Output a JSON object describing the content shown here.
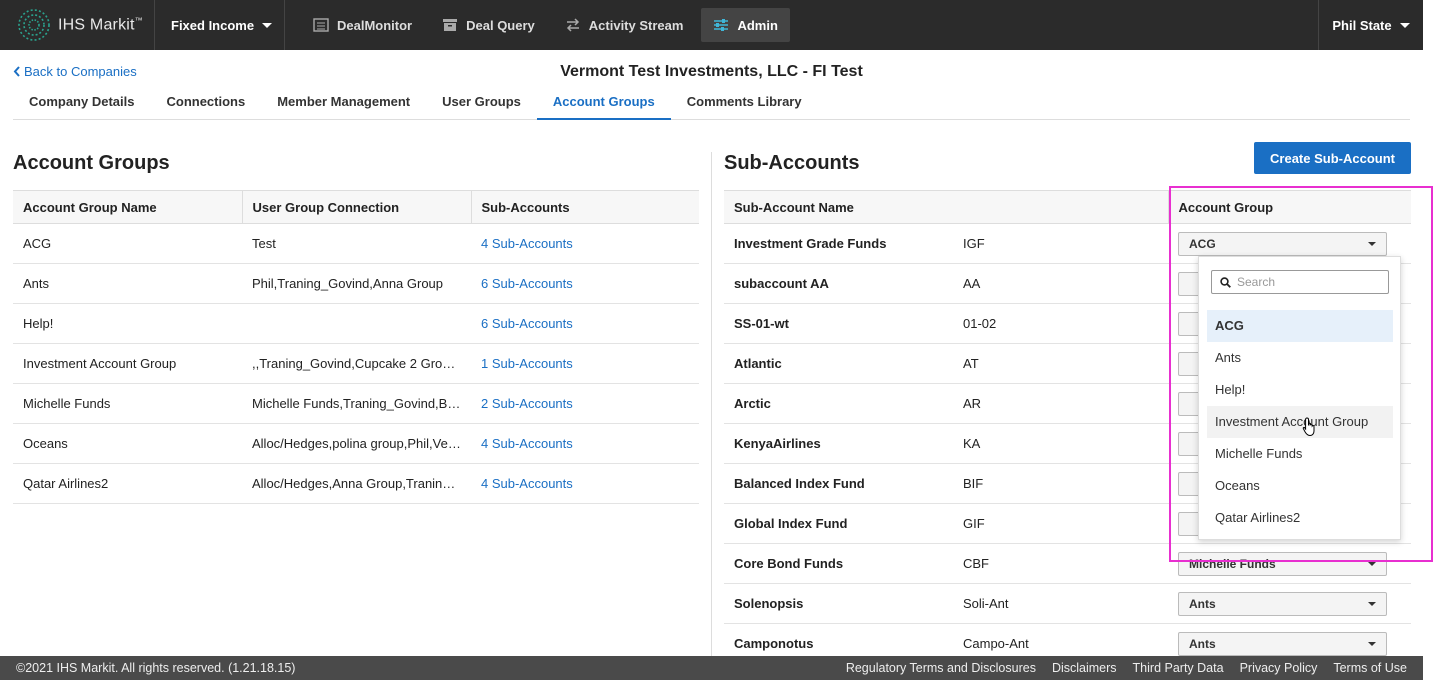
{
  "nav": {
    "brand": "IHS Markit",
    "brand_mark": "™",
    "product": "Fixed Income",
    "links": [
      {
        "label": "DealMonitor",
        "icon": "list-icon"
      },
      {
        "label": "Deal Query",
        "icon": "archive-icon"
      },
      {
        "label": "Activity Stream",
        "icon": "swap-arrows-icon"
      },
      {
        "label": "Admin",
        "icon": "sliders-icon"
      }
    ],
    "user": "Phil State"
  },
  "header": {
    "back_label": "Back to Companies",
    "title": "Vermont Test Investments, LLC - FI Test"
  },
  "tabs": [
    {
      "label": "Company Details"
    },
    {
      "label": "Connections"
    },
    {
      "label": "Member Management"
    },
    {
      "label": "User Groups"
    },
    {
      "label": "Account Groups"
    },
    {
      "label": "Comments Library"
    }
  ],
  "account_groups": {
    "title": "Account Groups",
    "columns": [
      "Account Group Name",
      "User Group Connection",
      "Sub-Accounts"
    ],
    "rows": [
      {
        "name": "ACG",
        "connection": "Test",
        "subs": "4 Sub-Accounts"
      },
      {
        "name": "Ants",
        "connection": "Phil,Traning_Govind,Anna Group",
        "subs": "6 Sub-Accounts"
      },
      {
        "name": "Help!",
        "connection": "",
        "subs": "6 Sub-Accounts"
      },
      {
        "name": "Investment Account Group",
        "connection": ",,Traning_Govind,Cupcake 2 Group,...",
        "subs": "1 Sub-Accounts"
      },
      {
        "name": "Michelle Funds",
        "connection": "Michelle Funds,Traning_Govind,Bu...",
        "subs": "2 Sub-Accounts"
      },
      {
        "name": "Oceans",
        "connection": "Alloc/Hedges,polina group,Phil,Ver...",
        "subs": "4 Sub-Accounts"
      },
      {
        "name": "Qatar Airlines2",
        "connection": "Alloc/Hedges,Anna Group,Traning_...",
        "subs": "4 Sub-Accounts"
      }
    ]
  },
  "sub_accounts": {
    "title": "Sub-Accounts",
    "create_label": "Create Sub-Account",
    "columns": [
      "Sub-Account Name",
      "",
      "Account Group"
    ],
    "rows": [
      {
        "name": "Investment Grade Funds",
        "code": "IGF",
        "group": "ACG"
      },
      {
        "name": "subaccount AA",
        "code": "AA",
        "group": ""
      },
      {
        "name": "SS-01-wt",
        "code": "01-02",
        "group": ""
      },
      {
        "name": "Atlantic",
        "code": "AT",
        "group": ""
      },
      {
        "name": "Arctic",
        "code": "AR",
        "group": ""
      },
      {
        "name": "KenyaAirlines",
        "code": "KA",
        "group": ""
      },
      {
        "name": "Balanced Index Fund",
        "code": "BIF",
        "group": ""
      },
      {
        "name": "Global Index Fund",
        "code": "GIF",
        "group": ""
      },
      {
        "name": "Core Bond Funds",
        "code": "CBF",
        "group": "Michelle Funds"
      },
      {
        "name": "Solenopsis",
        "code": "Soli-Ant",
        "group": "Ants"
      },
      {
        "name": "Camponotus",
        "code": "Campo-Ant",
        "group": "Ants"
      }
    ]
  },
  "dropdown": {
    "search_placeholder": "Search",
    "options": [
      "ACG",
      "Ants",
      "Help!",
      "Investment Account Group",
      "Michelle Funds",
      "Oceans",
      "Qatar Airlines2"
    ],
    "selected": "ACG",
    "hovered": "Investment Account Group"
  },
  "footer": {
    "copyright": "©2021 IHS Markit. All rights reserved. (1.21.18.15)",
    "links": [
      "Regulatory Terms and Disclosures",
      "Disclaimers",
      "Third Party Data",
      "Privacy Policy",
      "Terms of Use"
    ]
  },
  "colors": {
    "accent": "#1a6fc4",
    "highlight": "#e82fd0",
    "topbar": "#2b2b2b"
  }
}
